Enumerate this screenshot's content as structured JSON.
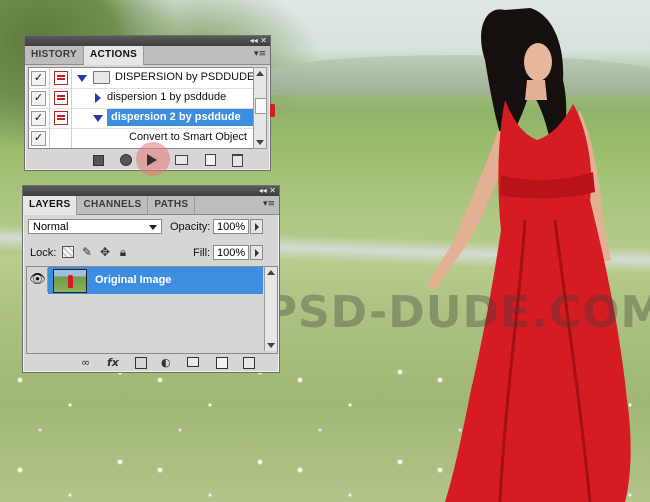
{
  "photo": {
    "watermark": "WWW.PSD-DUDE.COM",
    "dress_color": "#d41c22"
  },
  "actions_panel": {
    "tabs": [
      "HISTORY",
      "ACTIONS"
    ],
    "active_tab": "ACTIONS",
    "items": [
      {
        "checked": true,
        "dialog": true,
        "label": "DISPERSION by PSDDUDE",
        "kind": "set",
        "expanded": true
      },
      {
        "checked": true,
        "dialog": true,
        "label": "dispersion 1 by psddude",
        "kind": "action",
        "expanded": false
      },
      {
        "checked": true,
        "dialog": true,
        "label": "dispersion 2 by psddude",
        "kind": "action",
        "expanded": true,
        "selected": true
      },
      {
        "checked": true,
        "dialog": false,
        "label": "Convert to Smart Object",
        "kind": "step"
      }
    ],
    "toolbar_icons": [
      "stop-icon",
      "record-icon",
      "play-icon",
      "new-set-icon",
      "new-action-icon",
      "trash-icon"
    ],
    "highlight_color": "#3d8ee0"
  },
  "layers_panel": {
    "tabs": [
      "LAYERS",
      "CHANNELS",
      "PATHS"
    ],
    "active_tab": "LAYERS",
    "blend_mode": "Normal",
    "opacity_label": "Opacity:",
    "opacity_value": "100%",
    "lock_label": "Lock:",
    "fill_label": "Fill:",
    "fill_value": "100%",
    "layers": [
      {
        "name": "Original Image",
        "visible": true,
        "selected": true
      }
    ],
    "footer_icons": [
      "link-icon",
      "fx-icon",
      "mask-icon",
      "adjustment-icon",
      "group-icon",
      "new-layer-icon",
      "trash-icon"
    ],
    "fx_label": "fx"
  }
}
